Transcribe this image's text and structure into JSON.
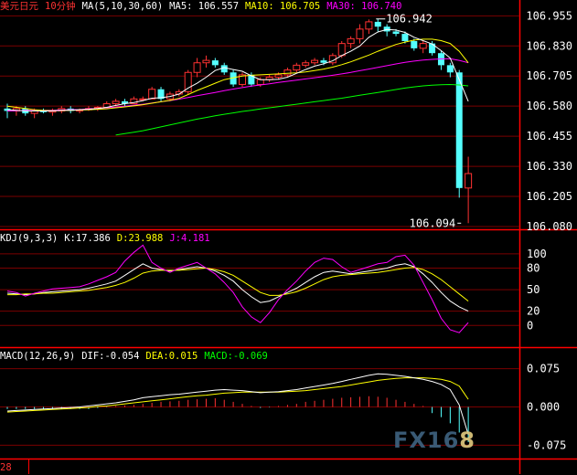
{
  "symbol": "美元日元",
  "period": "10分钟",
  "ma_header": {
    "label": "MA(5,10,30,60)",
    "ma5": "MA5: 106.557",
    "ma10": "MA10: 106.705",
    "ma30": "MA30: 106.740"
  },
  "kdj_header": {
    "label": "KDJ(9,3,3)",
    "k": "K:17.386",
    "d": "D:23.988",
    "j": "J:4.181"
  },
  "macd_header": {
    "label": "MACD(12,26,9)",
    "dif": "DIF:-0.054",
    "dea": "DEA:0.015",
    "macd": "MACD:-0.069"
  },
  "bottom_label": "28",
  "watermark": {
    "part1": "FX16",
    "part2": "8"
  },
  "colors": {
    "up": "#ff3232",
    "down": "#54ffff",
    "ma5": "#ffffff",
    "ma10": "#ffff00",
    "ma30": "#ff00ff",
    "ma60": "#00ff00",
    "grid": "#7a0000",
    "axis": "#ff0000"
  },
  "chart_data": [
    {
      "type": "candlestick",
      "title": "美元日元 10分钟",
      "y_ticks": [
        "106.955",
        "106.830",
        "106.705",
        "106.580",
        "106.455",
        "106.330",
        "106.205",
        "106.080"
      ],
      "ylim": [
        106.08,
        106.96
      ],
      "annotations": [
        {
          "text": "106.942",
          "value": 106.942,
          "index": 41
        },
        {
          "text": "106.094",
          "value": 106.094,
          "index": 50
        }
      ],
      "candles": [
        {
          "o": 106.57,
          "h": 106.59,
          "l": 106.53,
          "c": 106.56
        },
        {
          "o": 106.56,
          "h": 106.58,
          "l": 106.54,
          "c": 106.57
        },
        {
          "o": 106.57,
          "h": 106.58,
          "l": 106.54,
          "c": 106.55
        },
        {
          "o": 106.55,
          "h": 106.57,
          "l": 106.53,
          "c": 106.56
        },
        {
          "o": 106.56,
          "h": 106.57,
          "l": 106.55,
          "c": 106.555
        },
        {
          "o": 106.555,
          "h": 106.57,
          "l": 106.54,
          "c": 106.56
        },
        {
          "o": 106.56,
          "h": 106.58,
          "l": 106.55,
          "c": 106.57
        },
        {
          "o": 106.57,
          "h": 106.58,
          "l": 106.55,
          "c": 106.56
        },
        {
          "o": 106.56,
          "h": 106.57,
          "l": 106.55,
          "c": 106.565
        },
        {
          "o": 106.565,
          "h": 106.58,
          "l": 106.56,
          "c": 106.57
        },
        {
          "o": 106.57,
          "h": 106.58,
          "l": 106.56,
          "c": 106.575
        },
        {
          "o": 106.575,
          "h": 106.6,
          "l": 106.57,
          "c": 106.59
        },
        {
          "o": 106.59,
          "h": 106.61,
          "l": 106.58,
          "c": 106.6
        },
        {
          "o": 106.6,
          "h": 106.61,
          "l": 106.58,
          "c": 106.59
        },
        {
          "o": 106.59,
          "h": 106.62,
          "l": 106.59,
          "c": 106.61
        },
        {
          "o": 106.61,
          "h": 106.62,
          "l": 106.6,
          "c": 106.61
        },
        {
          "o": 106.61,
          "h": 106.66,
          "l": 106.61,
          "c": 106.65
        },
        {
          "o": 106.65,
          "h": 106.66,
          "l": 106.6,
          "c": 106.61
        },
        {
          "o": 106.61,
          "h": 106.64,
          "l": 106.6,
          "c": 106.63
        },
        {
          "o": 106.63,
          "h": 106.65,
          "l": 106.62,
          "c": 106.64
        },
        {
          "o": 106.64,
          "h": 106.73,
          "l": 106.63,
          "c": 106.72
        },
        {
          "o": 106.72,
          "h": 106.78,
          "l": 106.7,
          "c": 106.76
        },
        {
          "o": 106.76,
          "h": 106.79,
          "l": 106.74,
          "c": 106.77
        },
        {
          "o": 106.77,
          "h": 106.78,
          "l": 106.74,
          "c": 106.75
        },
        {
          "o": 106.75,
          "h": 106.76,
          "l": 106.71,
          "c": 106.72
        },
        {
          "o": 106.72,
          "h": 106.73,
          "l": 106.66,
          "c": 106.67
        },
        {
          "o": 106.67,
          "h": 106.72,
          "l": 106.66,
          "c": 106.71
        },
        {
          "o": 106.71,
          "h": 106.72,
          "l": 106.66,
          "c": 106.67
        },
        {
          "o": 106.67,
          "h": 106.7,
          "l": 106.66,
          "c": 106.69
        },
        {
          "o": 106.69,
          "h": 106.71,
          "l": 106.68,
          "c": 106.7
        },
        {
          "o": 106.7,
          "h": 106.72,
          "l": 106.69,
          "c": 106.71
        },
        {
          "o": 106.71,
          "h": 106.74,
          "l": 106.7,
          "c": 106.73
        },
        {
          "o": 106.73,
          "h": 106.76,
          "l": 106.72,
          "c": 106.75
        },
        {
          "o": 106.75,
          "h": 106.77,
          "l": 106.74,
          "c": 106.76
        },
        {
          "o": 106.76,
          "h": 106.78,
          "l": 106.75,
          "c": 106.77
        },
        {
          "o": 106.77,
          "h": 106.78,
          "l": 106.75,
          "c": 106.76
        },
        {
          "o": 106.76,
          "h": 106.8,
          "l": 106.75,
          "c": 106.79
        },
        {
          "o": 106.79,
          "h": 106.85,
          "l": 106.78,
          "c": 106.84
        },
        {
          "o": 106.84,
          "h": 106.87,
          "l": 106.82,
          "c": 106.86
        },
        {
          "o": 106.86,
          "h": 106.92,
          "l": 106.84,
          "c": 106.9
        },
        {
          "o": 106.9,
          "h": 106.94,
          "l": 106.88,
          "c": 106.93
        },
        {
          "o": 106.93,
          "h": 106.942,
          "l": 106.89,
          "c": 106.91
        },
        {
          "o": 106.91,
          "h": 106.92,
          "l": 106.87,
          "c": 106.89
        },
        {
          "o": 106.89,
          "h": 106.9,
          "l": 106.87,
          "c": 106.88
        },
        {
          "o": 106.88,
          "h": 106.89,
          "l": 106.84,
          "c": 106.85
        },
        {
          "o": 106.85,
          "h": 106.86,
          "l": 106.81,
          "c": 106.82
        },
        {
          "o": 106.82,
          "h": 106.85,
          "l": 106.8,
          "c": 106.84
        },
        {
          "o": 106.84,
          "h": 106.85,
          "l": 106.79,
          "c": 106.8
        },
        {
          "o": 106.8,
          "h": 106.81,
          "l": 106.73,
          "c": 106.75
        },
        {
          "o": 106.75,
          "h": 106.76,
          "l": 106.7,
          "c": 106.72
        },
        {
          "o": 106.72,
          "h": 106.73,
          "l": 106.2,
          "c": 106.24
        },
        {
          "o": 106.24,
          "h": 106.37,
          "l": 106.094,
          "c": 106.3
        }
      ],
      "ma5": [
        106.565,
        106.563,
        106.56,
        106.56,
        106.56,
        106.56,
        106.563,
        106.563,
        106.565,
        106.567,
        106.57,
        106.575,
        106.583,
        106.59,
        106.595,
        106.603,
        106.613,
        106.615,
        106.62,
        106.63,
        106.655,
        106.675,
        106.7,
        106.728,
        106.74,
        106.732,
        106.725,
        106.706,
        106.69,
        106.69,
        106.692,
        106.7,
        106.716,
        106.732,
        106.746,
        106.756,
        106.768,
        106.79,
        106.808,
        106.83,
        106.866,
        106.888,
        106.898,
        106.896,
        106.886,
        106.866,
        106.852,
        106.838,
        106.81,
        106.78,
        106.69,
        106.6
      ],
      "ma10": [
        106.58,
        106.575,
        106.57,
        106.565,
        106.562,
        106.561,
        106.562,
        106.563,
        106.564,
        106.565,
        106.567,
        106.569,
        106.573,
        106.577,
        106.581,
        106.586,
        106.592,
        106.598,
        106.604,
        106.612,
        106.628,
        106.645,
        106.66,
        106.675,
        106.69,
        106.698,
        106.705,
        106.708,
        106.71,
        106.712,
        106.714,
        106.716,
        106.718,
        106.722,
        106.728,
        106.734,
        106.742,
        106.752,
        106.764,
        106.778,
        106.792,
        106.808,
        106.822,
        106.836,
        106.846,
        106.854,
        106.858,
        106.858,
        106.852,
        106.84,
        106.808,
        106.76
      ],
      "ma30": [
        106.56,
        106.561,
        106.562,
        106.562,
        106.563,
        106.563,
        106.564,
        106.565,
        106.566,
        106.568,
        106.57,
        106.573,
        106.576,
        106.58,
        106.584,
        106.588,
        106.593,
        106.598,
        106.603,
        106.609,
        106.616,
        106.623,
        106.63,
        106.637,
        106.644,
        106.651,
        106.657,
        106.663,
        106.668,
        106.673,
        106.678,
        106.683,
        106.688,
        106.693,
        106.698,
        106.703,
        106.708,
        106.714,
        106.72,
        106.727,
        106.734,
        106.741,
        106.748,
        106.755,
        106.762,
        106.767,
        106.771,
        106.774,
        106.776,
        106.777,
        106.77,
        106.76
      ],
      "ma60": [
        null,
        null,
        null,
        null,
        null,
        null,
        null,
        null,
        null,
        null,
        null,
        null,
        106.46,
        106.466,
        106.472,
        106.478,
        106.486,
        106.494,
        106.502,
        106.51,
        106.518,
        106.526,
        106.533,
        106.54,
        106.546,
        106.552,
        106.558,
        106.563,
        106.568,
        106.573,
        106.578,
        106.583,
        106.588,
        106.593,
        106.598,
        106.603,
        106.608,
        106.613,
        106.619,
        106.625,
        106.631,
        106.637,
        106.643,
        106.649,
        106.655,
        106.66,
        106.664,
        106.667,
        106.669,
        106.67,
        106.668,
        106.664
      ]
    },
    {
      "type": "line",
      "title": "KDJ(9,3,3)",
      "y_ticks": [
        "100",
        "80",
        "50",
        "20",
        "0"
      ],
      "ylim": [
        -20,
        110
      ],
      "series": [
        {
          "name": "K",
          "values": [
            45,
            44,
            43,
            44,
            46,
            47,
            48,
            49,
            50,
            52,
            55,
            58,
            62,
            70,
            78,
            86,
            80,
            78,
            76,
            78,
            80,
            82,
            80,
            76,
            70,
            62,
            50,
            40,
            32,
            34,
            40,
            46,
            52,
            60,
            68,
            74,
            76,
            74,
            72,
            74,
            76,
            78,
            80,
            84,
            86,
            82,
            72,
            60,
            46,
            34,
            26,
            20
          ]
        },
        {
          "name": "D",
          "values": [
            43,
            43,
            44,
            44,
            45,
            45,
            46,
            47,
            48,
            49,
            51,
            53,
            56,
            60,
            66,
            73,
            76,
            77,
            77,
            77,
            78,
            79,
            80,
            78,
            75,
            70,
            62,
            54,
            46,
            42,
            42,
            44,
            47,
            52,
            58,
            64,
            68,
            70,
            71,
            72,
            73,
            74,
            76,
            78,
            80,
            81,
            78,
            72,
            64,
            54,
            44,
            34
          ]
        },
        {
          "name": "J",
          "values": [
            48,
            46,
            41,
            45,
            48,
            51,
            52,
            53,
            54,
            58,
            63,
            68,
            74,
            90,
            102,
            112,
            88,
            80,
            74,
            80,
            84,
            88,
            80,
            72,
            60,
            46,
            26,
            12,
            4,
            18,
            36,
            50,
            62,
            76,
            88,
            94,
            92,
            82,
            74,
            78,
            82,
            86,
            88,
            96,
            98,
            84,
            60,
            36,
            10,
            -6,
            -10,
            4
          ]
        }
      ]
    },
    {
      "type": "bar+line",
      "title": "MACD(12,26,9)",
      "y_ticks": [
        "0.075",
        "0.000",
        "-0.075"
      ],
      "ylim": [
        -0.085,
        0.085
      ],
      "series": [
        {
          "name": "DIF",
          "values": [
            -0.008,
            -0.007,
            -0.006,
            -0.005,
            -0.004,
            -0.003,
            -0.002,
            -0.001,
            0.0,
            0.002,
            0.004,
            0.006,
            0.008,
            0.011,
            0.014,
            0.018,
            0.02,
            0.022,
            0.024,
            0.025,
            0.027,
            0.029,
            0.031,
            0.033,
            0.034,
            0.033,
            0.032,
            0.03,
            0.028,
            0.029,
            0.03,
            0.032,
            0.034,
            0.037,
            0.04,
            0.043,
            0.046,
            0.05,
            0.054,
            0.058,
            0.062,
            0.065,
            0.064,
            0.062,
            0.06,
            0.057,
            0.054,
            0.05,
            0.044,
            0.034,
            0.004,
            -0.054
          ]
        },
        {
          "name": "DEA",
          "values": [
            -0.01,
            -0.009,
            -0.008,
            -0.007,
            -0.006,
            -0.005,
            -0.004,
            -0.003,
            -0.002,
            -0.001,
            0.001,
            0.002,
            0.004,
            0.006,
            0.008,
            0.01,
            0.012,
            0.014,
            0.016,
            0.018,
            0.02,
            0.022,
            0.023,
            0.025,
            0.027,
            0.028,
            0.029,
            0.029,
            0.029,
            0.029,
            0.029,
            0.03,
            0.031,
            0.032,
            0.034,
            0.036,
            0.038,
            0.04,
            0.043,
            0.046,
            0.049,
            0.052,
            0.054,
            0.056,
            0.057,
            0.057,
            0.057,
            0.056,
            0.054,
            0.05,
            0.041,
            0.015
          ]
        },
        {
          "name": "MACD",
          "values": [
            -0.004,
            -0.004,
            -0.004,
            -0.004,
            -0.004,
            -0.004,
            -0.004,
            -0.004,
            -0.004,
            -0.004,
            -0.002,
            -0.001,
            0.002,
            0.003,
            0.004,
            0.006,
            0.008,
            0.01,
            0.011,
            0.012,
            0.014,
            0.015,
            0.016,
            0.017,
            0.014,
            0.01,
            0.006,
            0.002,
            -0.002,
            -0.001,
            0.002,
            0.004,
            0.006,
            0.01,
            0.012,
            0.014,
            0.016,
            0.018,
            0.019,
            0.02,
            0.021,
            0.02,
            0.018,
            0.014,
            0.01,
            0.006,
            0.002,
            -0.012,
            -0.02,
            -0.032,
            -0.05,
            -0.069
          ]
        }
      ]
    }
  ]
}
